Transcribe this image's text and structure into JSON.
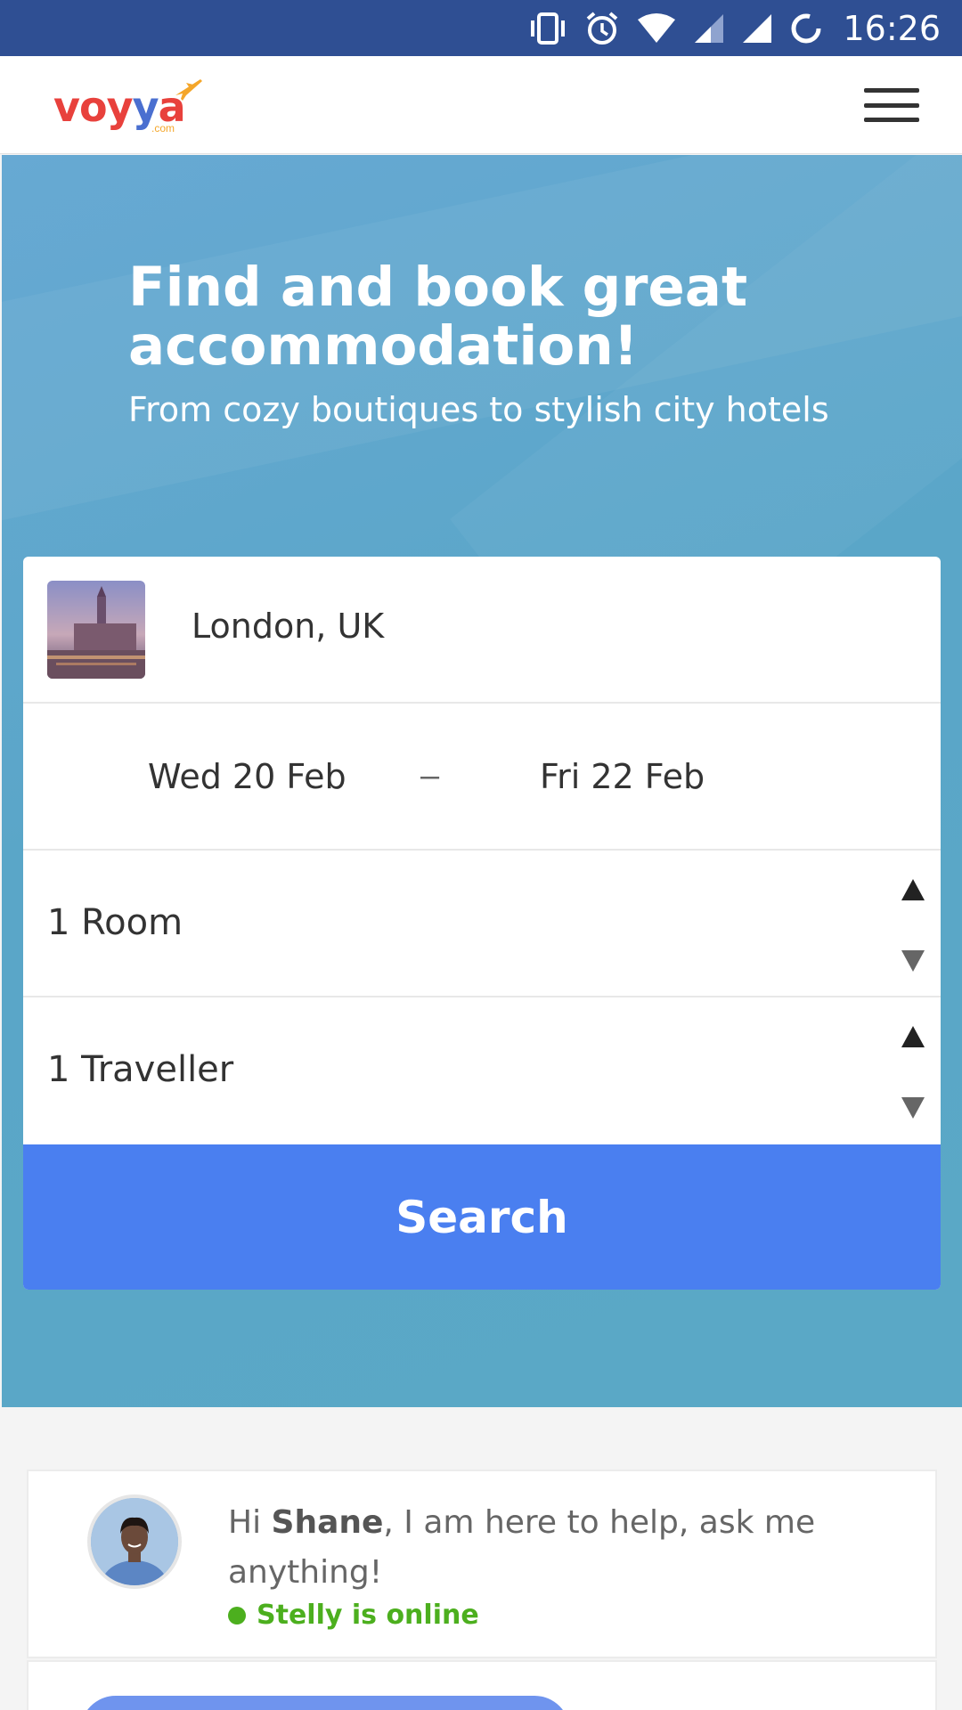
{
  "status_bar": {
    "time": "16:26",
    "icons": [
      "vibrate-icon",
      "alarm-icon",
      "wifi-icon",
      "signal-icon",
      "signal-icon",
      "loading-icon"
    ]
  },
  "header": {
    "logo": {
      "name": "voyya",
      "suffix": ".com"
    },
    "menu_icon": "hamburger-menu-icon"
  },
  "hero": {
    "title": "Find and book great accommodation!",
    "subtitle": "From cozy boutiques to stylish city hotels"
  },
  "search": {
    "destination": "London, UK",
    "checkin": "Wed 20 Feb",
    "separator": "–",
    "checkout": "Fri 22 Feb",
    "rooms": "1 Room",
    "travellers": "1 Traveller",
    "button_label": "Search"
  },
  "chat": {
    "greeting_prefix": "Hi ",
    "user_name": "Shane",
    "greeting_suffix": ", I am here to help, ask me anything!",
    "status": "Stelly is online"
  },
  "colors": {
    "status_bar": "#2f4f93",
    "hero_bg": "#5aa6c8",
    "search_button": "#4a7ff0",
    "online": "#4caf1e"
  }
}
